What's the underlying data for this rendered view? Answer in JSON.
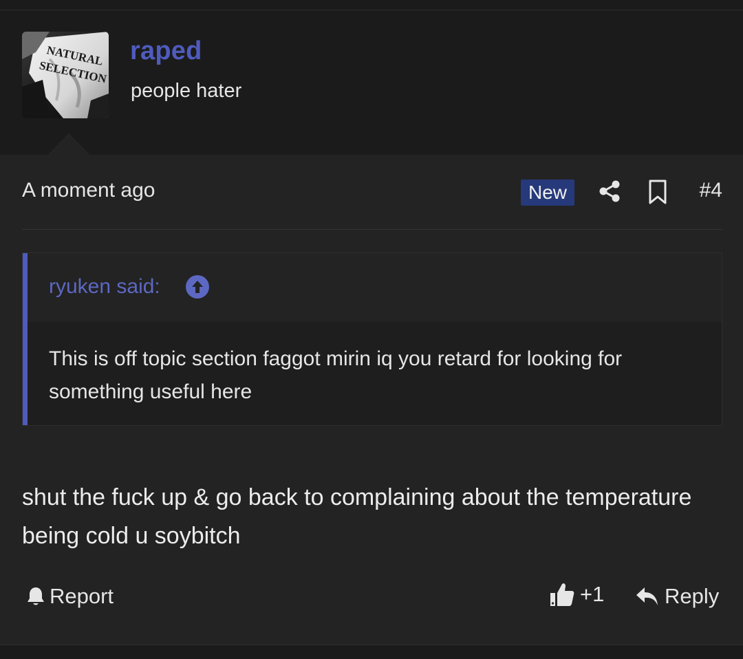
{
  "user": {
    "name": "raped",
    "title": "people hater",
    "avatar_text_line1": "NATURAL",
    "avatar_text_line2": "SELECTION"
  },
  "post": {
    "timestamp": "A moment ago",
    "badge": "New",
    "number": "#4",
    "icons": {
      "share": "share-icon",
      "bookmark": "bookmark-icon",
      "quote_jump": "arrow-up-circle-icon",
      "report": "bell-icon",
      "like": "thumbs-up-icon",
      "reply": "reply-arrow-icon"
    }
  },
  "quote": {
    "author_label": "ryuken said:",
    "text": "This is off topic section faggot mirin iq you retard for looking for something useful here"
  },
  "message": {
    "text": "shut the fuck up & go back to complaining about the temperature being cold u soybitch"
  },
  "actions": {
    "report_label": "Report",
    "like_count": "+1",
    "reply_label": "Reply"
  },
  "colors": {
    "accent": "#4f5bbd",
    "badge_bg": "#26397a",
    "post_bg": "#232323",
    "page_bg": "#1b1b1b"
  }
}
